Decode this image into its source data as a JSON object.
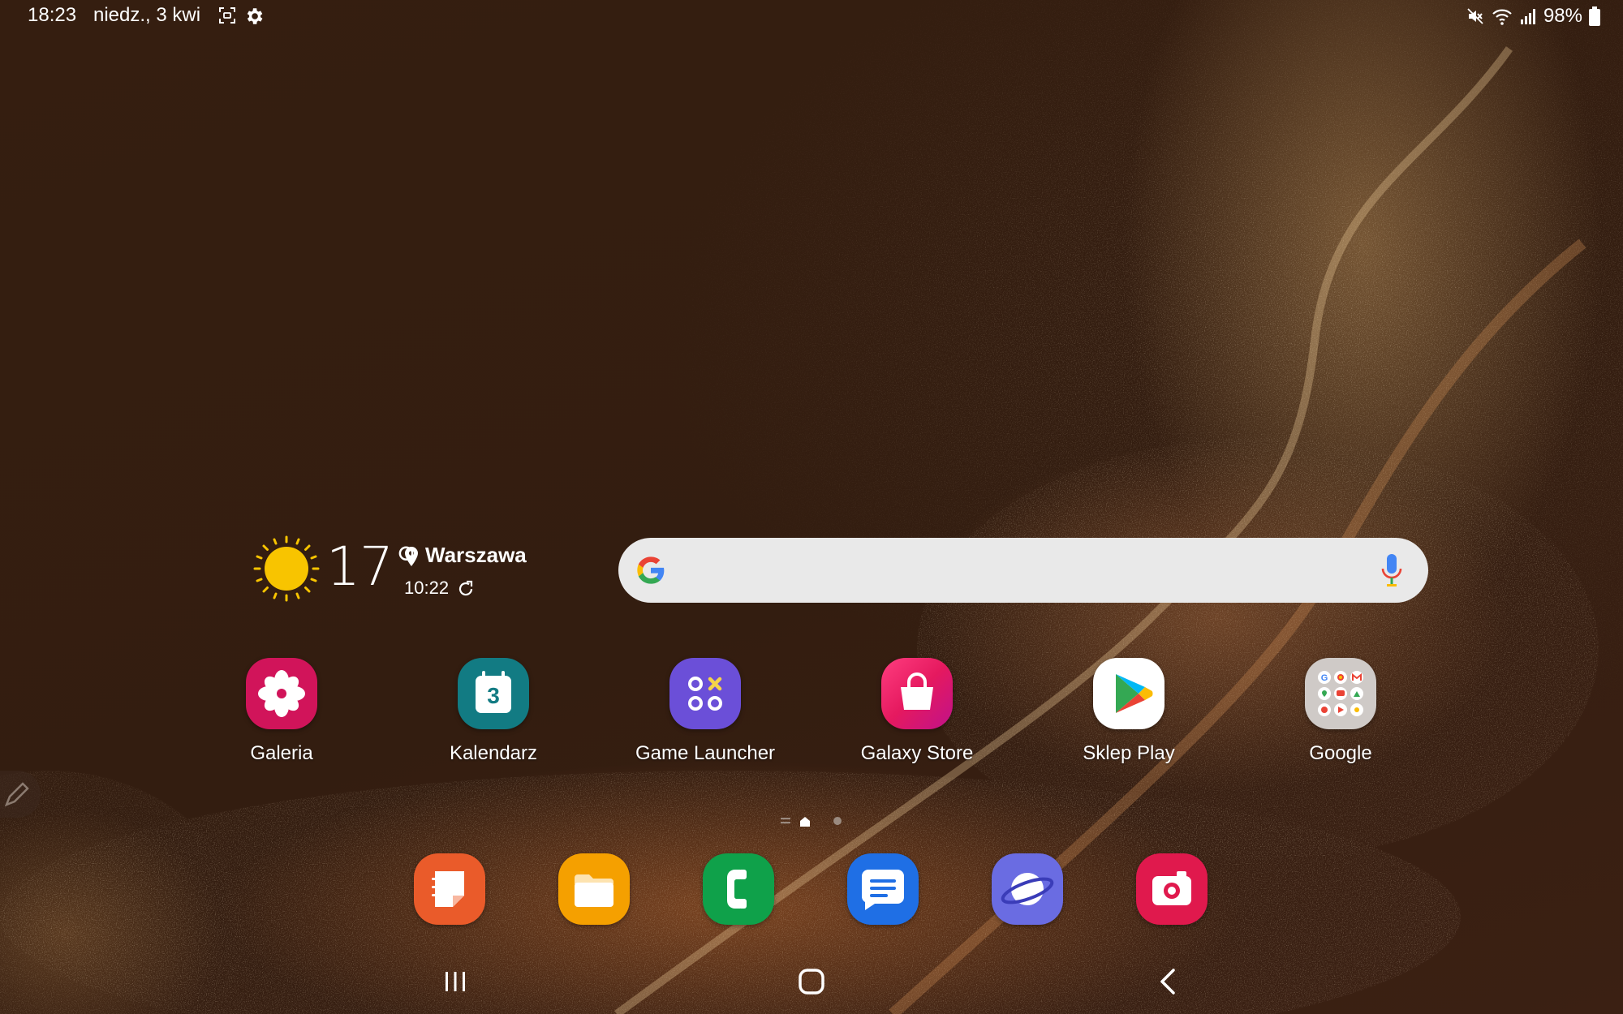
{
  "status_bar": {
    "time": "18:23",
    "date": "niedz., 3 kwi",
    "battery": "98%"
  },
  "weather": {
    "temperature": "17°",
    "location": "Warszawa",
    "updated": "10:22"
  },
  "search": {
    "placeholder": ""
  },
  "apps": [
    {
      "label": "Galeria",
      "icon": "gallery-icon",
      "color": "#d1145a"
    },
    {
      "label": "Kalendarz",
      "icon": "calendar-icon",
      "color": "#127b83",
      "day": "3"
    },
    {
      "label": "Game Launcher",
      "icon": "game-launcher-icon",
      "color": "#6b4fd8"
    },
    {
      "label": "Galaxy Store",
      "icon": "galaxy-store-icon",
      "color": "#e5195f"
    },
    {
      "label": "Sklep Play",
      "icon": "play-store-icon",
      "color": "#ffffff"
    },
    {
      "label": "Google",
      "icon": "google-folder-icon",
      "color": "#cfcfcf"
    }
  ],
  "dock": [
    {
      "name": "samsung-notes",
      "icon": "notes-icon",
      "color": "#ea5b2a"
    },
    {
      "name": "my-files",
      "icon": "folder-icon",
      "color": "#f5a000"
    },
    {
      "name": "phone",
      "icon": "phone-icon",
      "color": "#0fa14a"
    },
    {
      "name": "messages",
      "icon": "messages-icon",
      "color": "#1f6fe5"
    },
    {
      "name": "internet",
      "icon": "internet-icon",
      "color": "#6a6ce2"
    },
    {
      "name": "camera",
      "icon": "camera-icon",
      "color": "#e0194d"
    }
  ],
  "page_indicator": {
    "pages": 2,
    "current": 1
  }
}
